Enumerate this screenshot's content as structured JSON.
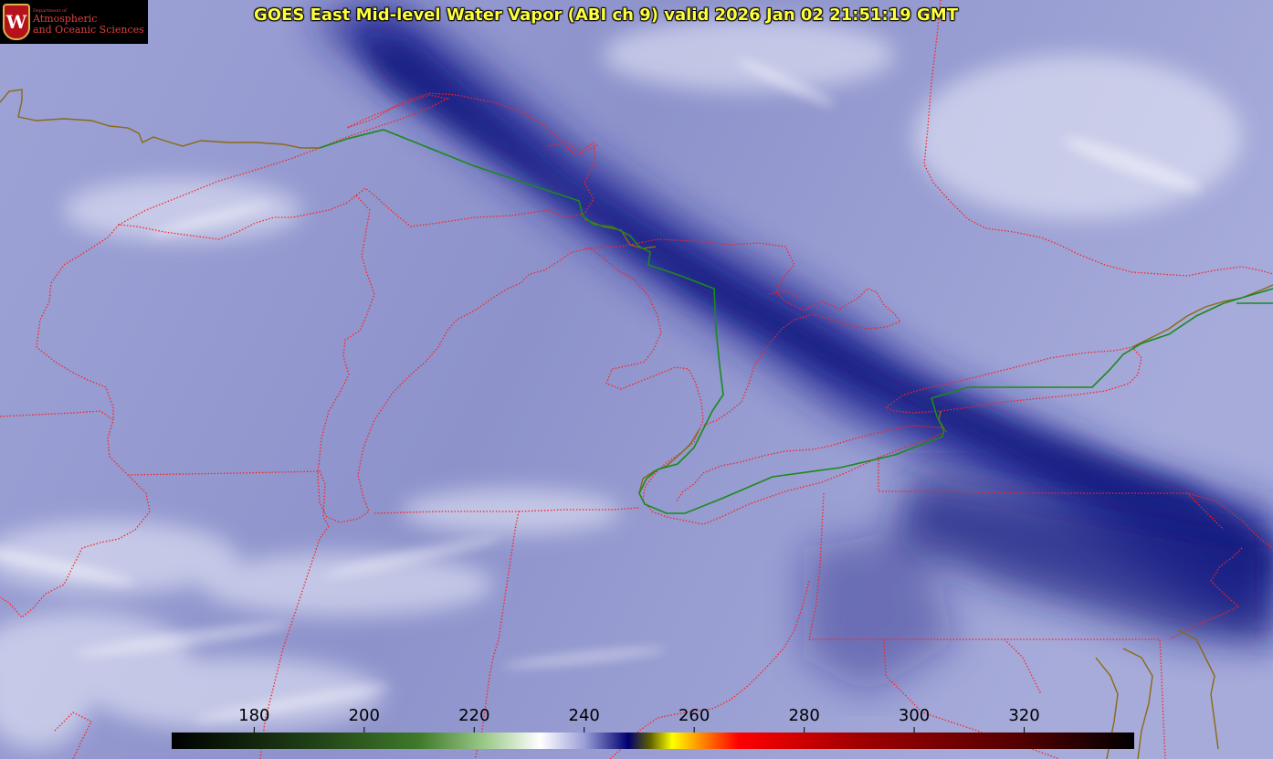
{
  "logo": {
    "department_line": "Department of",
    "line1": "Atmospheric",
    "line2": "and Oceanic Sciences",
    "crest_letter": "W",
    "icon": "uw-crest-icon"
  },
  "title": "GOES East Mid-level Water Vapor (ABI ch 9)  valid 2026 Jan 02 21:51:19 GMT",
  "colorbar": {
    "ticks": [
      180,
      200,
      220,
      240,
      260,
      280,
      300,
      320
    ],
    "range": [
      165,
      340
    ],
    "stops": [
      {
        "v": 165,
        "c": "#000000"
      },
      {
        "v": 190,
        "c": "#1f3f16"
      },
      {
        "v": 210,
        "c": "#3f7a2a"
      },
      {
        "v": 222,
        "c": "#9cc98a"
      },
      {
        "v": 232,
        "c": "#ffffff"
      },
      {
        "v": 240,
        "c": "#9aa0d8"
      },
      {
        "v": 248,
        "c": "#000070"
      },
      {
        "v": 252,
        "c": "#606000"
      },
      {
        "v": 256,
        "c": "#ffff00"
      },
      {
        "v": 261,
        "c": "#ff9000"
      },
      {
        "v": 268,
        "c": "#ff0000"
      },
      {
        "v": 290,
        "c": "#a00000"
      },
      {
        "v": 320,
        "c": "#500000"
      },
      {
        "v": 340,
        "c": "#000000"
      }
    ]
  },
  "colors": {
    "state_border": "#ff2020",
    "country_border": "#1a8a1a",
    "coastline": "#8a6a10",
    "title": "#ffff3c"
  }
}
